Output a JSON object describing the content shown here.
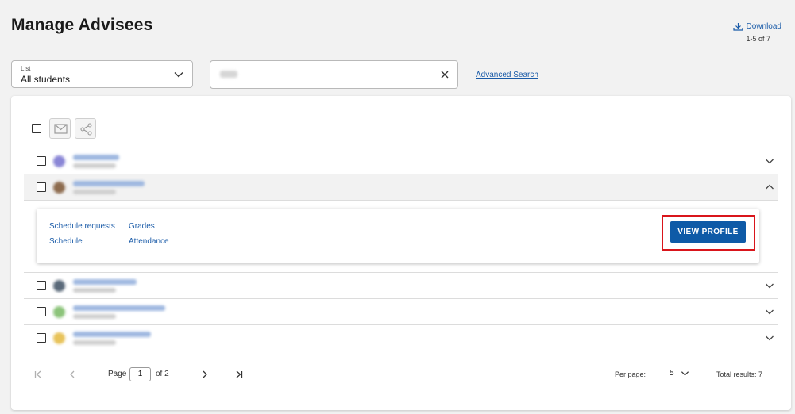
{
  "page": {
    "title": "Manage Advisees"
  },
  "list_filter": {
    "label": "List",
    "value": "All students"
  },
  "search": {
    "value": ""
  },
  "advanced_search": {
    "label": "Advanced Search"
  },
  "toolbar": {
    "download_label": "Download",
    "range_text": "1-5 of 7"
  },
  "students": [
    {
      "avatar_color": "#8a86d6",
      "expanded": false
    },
    {
      "avatar_color": "#8d6b4e",
      "expanded": true
    },
    {
      "avatar_color": "#5b6a7a",
      "expanded": false
    },
    {
      "avatar_color": "#8cc47a",
      "expanded": false
    },
    {
      "avatar_color": "#e8c35a",
      "expanded": false
    }
  ],
  "detail": {
    "links": [
      "Schedule requests",
      "Grades",
      "Schedule",
      "Attendance"
    ],
    "view_profile_label": "VIEW PROFILE"
  },
  "pagination": {
    "page_label": "Page",
    "current_page": "1",
    "of_label": "of 2",
    "per_page_label": "Per page:",
    "per_page_value": "5",
    "total_results": "Total results: 7"
  },
  "colors": {
    "link": "#1a5ba8",
    "primary_button": "#0e5aa7",
    "highlight": "#d9151b"
  }
}
